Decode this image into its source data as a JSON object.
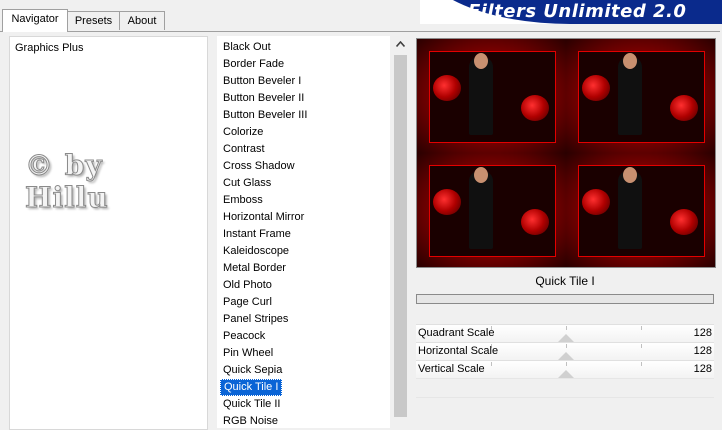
{
  "tabs": [
    {
      "label": "Navigator",
      "active": true
    },
    {
      "label": "Presets",
      "active": false
    },
    {
      "label": "About",
      "active": false
    }
  ],
  "app_title": "Filters Unlimited 2.0",
  "categories": [
    {
      "label": "Graphics Plus",
      "selected": false
    }
  ],
  "watermark": {
    "line1": "© by",
    "line2": "Hillu"
  },
  "filters": [
    {
      "label": "Black Out",
      "selected": false
    },
    {
      "label": "Border Fade",
      "selected": false
    },
    {
      "label": "Button Beveler I",
      "selected": false
    },
    {
      "label": "Button Beveler II",
      "selected": false
    },
    {
      "label": "Button Beveler III",
      "selected": false
    },
    {
      "label": "Colorize",
      "selected": false
    },
    {
      "label": "Contrast",
      "selected": false
    },
    {
      "label": "Cross Shadow",
      "selected": false
    },
    {
      "label": "Cut Glass",
      "selected": false
    },
    {
      "label": "Emboss",
      "selected": false
    },
    {
      "label": "Horizontal Mirror",
      "selected": false
    },
    {
      "label": "Instant Frame",
      "selected": false
    },
    {
      "label": "Kaleidoscope",
      "selected": false
    },
    {
      "label": "Metal Border",
      "selected": false
    },
    {
      "label": "Old Photo",
      "selected": false
    },
    {
      "label": "Page Curl",
      "selected": false
    },
    {
      "label": "Panel Stripes",
      "selected": false
    },
    {
      "label": "Peacock",
      "selected": false
    },
    {
      "label": "Pin Wheel",
      "selected": false
    },
    {
      "label": "Quick Sepia",
      "selected": false
    },
    {
      "label": "Quick Tile I",
      "selected": true
    },
    {
      "label": "Quick Tile II",
      "selected": false
    },
    {
      "label": "RGB Noise",
      "selected": false
    }
  ],
  "selected_filter_name": "Quick Tile I",
  "progress": 0,
  "parameters": [
    {
      "label": "Quadrant Scale",
      "value": "128"
    },
    {
      "label": "Horizontal Scale",
      "value": "128"
    },
    {
      "label": "Vertical Scale",
      "value": "128"
    }
  ],
  "colors": {
    "accent_blue": "#0a2a8c",
    "selection": "#0a64d6",
    "preview_red": "#c00000"
  },
  "icons": {
    "scroll_up": "chevron-up-icon"
  }
}
